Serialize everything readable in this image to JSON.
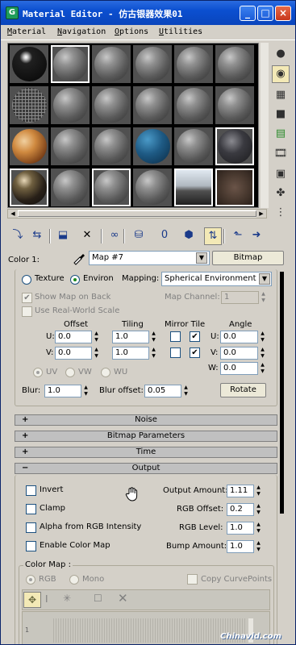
{
  "window": {
    "title": "Material Editor - 仿古银器效果01",
    "app_icon_letter": "G",
    "minimize": "_",
    "maximize": "□",
    "close": "×"
  },
  "menu": [
    {
      "hotkey": "M",
      "rest": "aterial"
    },
    {
      "hotkey": "N",
      "rest": "avigation"
    },
    {
      "hotkey": "O",
      "rest": "ptions"
    },
    {
      "hotkey": "U",
      "rest": "tilities"
    }
  ],
  "sample_slots": [
    [
      "black-glossy",
      "gray",
      "gray",
      "gray",
      "gray",
      "gray"
    ],
    [
      "gray-wireframe",
      "gray",
      "gray",
      "gray",
      "gray",
      "gray"
    ],
    [
      "orange-planet",
      "gray",
      "gray",
      "blue",
      "gray",
      "dark-rock"
    ],
    [
      "dark-metal",
      "gray",
      "gray",
      "gray",
      "landscape",
      "rusty-box"
    ]
  ],
  "side_tools": [
    "sample-type-icon",
    "backlight-icon",
    "background-checker-icon",
    "sample-uv-tiling-icon",
    "video-color-check-icon",
    "make-preview-icon",
    "options-icon",
    "select-by-material-icon",
    "material-map-navigator-icon"
  ],
  "bottom_tools": [
    "get-material-icon",
    "put-material-icon",
    "assign-material-icon",
    "reset-map-icon",
    "make-unique-icon",
    "put-to-library-icon",
    "material-effects-channel-icon",
    "show-map-in-viewport-icon",
    "show-end-result-icon",
    "go-to-parent-icon",
    "go-forward-to-sibling-icon"
  ],
  "color_row": {
    "label": "Color 1:",
    "map_name": "Map #7",
    "type_button": "Bitmap"
  },
  "coordinates": {
    "texture_label": "Texture",
    "environ_label": "Environ",
    "mapping_label": "Mapping:",
    "mapping_value": "Spherical Environment",
    "show_map_on_back": "Show Map on Back",
    "map_channel_label": "Map Channel:",
    "map_channel_value": "1",
    "use_real_world_scale": "Use Real-World Scale",
    "col_offset": "Offset",
    "col_tiling": "Tiling",
    "col_mirror_tile": "Mirror Tile",
    "col_angle": "Angle",
    "u_label": "U:",
    "v_label": "V:",
    "w_label": "W:",
    "u_offset": "0.0",
    "v_offset": "0.0",
    "u_tiling": "1.0",
    "v_tiling": "1.0",
    "u_angle": "0.0",
    "v_angle": "0.0",
    "w_angle": "0.0",
    "uv": "UV",
    "vw": "VW",
    "wu": "WU",
    "blur_label": "Blur:",
    "blur_value": "1.0",
    "blur_offset_label": "Blur offset:",
    "blur_offset_value": "0.05",
    "rotate_button": "Rotate"
  },
  "rollouts": [
    {
      "sign": "+",
      "label": "Noise"
    },
    {
      "sign": "+",
      "label": "Bitmap Parameters"
    },
    {
      "sign": "+",
      "label": "Time"
    },
    {
      "sign": "−",
      "label": "Output"
    }
  ],
  "output": {
    "invert": "Invert",
    "clamp": "Clamp",
    "alpha_from_rgb": "Alpha from RGB Intensity",
    "enable_color_map": "Enable Color Map",
    "output_amount_label": "Output Amount:",
    "output_amount_value": "1.11",
    "rgb_offset_label": "RGB Offset:",
    "rgb_offset_value": "0.2",
    "rgb_level_label": "RGB Level:",
    "rgb_level_value": "1.0",
    "bump_amount_label": "Bump Amount:",
    "bump_amount_value": "1.0"
  },
  "color_map": {
    "group_label": "Color Map :",
    "rgb": "RGB",
    "mono": "Mono",
    "copy_curve_points": "Copy CurvePoints",
    "graph_y_label": "1"
  },
  "watermark": "Chinavid.com"
}
